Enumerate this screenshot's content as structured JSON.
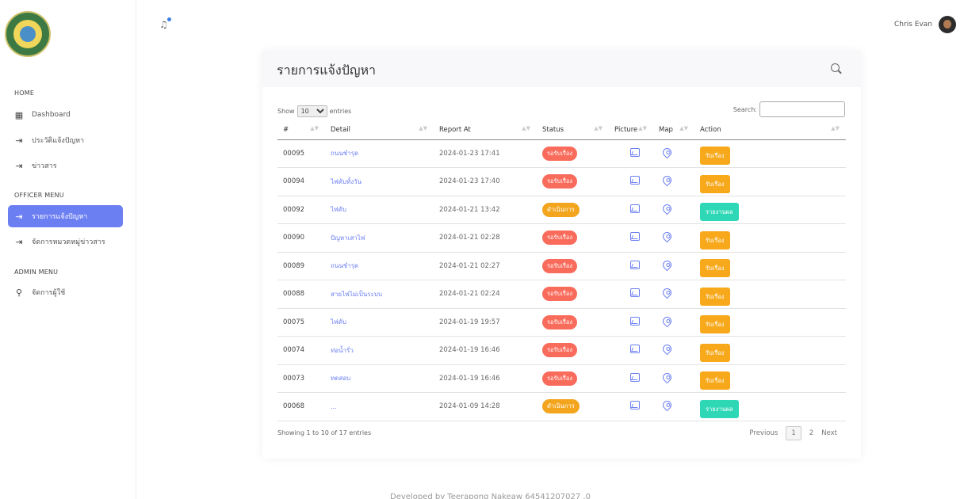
{
  "sidebar": {
    "home_heading": "HOME",
    "home_items": [
      {
        "label": "Dashboard",
        "icon": "grid-icon"
      },
      {
        "label": "ประวัติแจ้งปัญหา",
        "icon": "login-icon"
      },
      {
        "label": "ข่าวสาร",
        "icon": "login-icon"
      }
    ],
    "officer_heading": "OFFICER MENU",
    "officer_items": [
      {
        "label": "รายการแจ้งปัญหา",
        "icon": "login-icon",
        "active": true
      },
      {
        "label": "จัดการหมวดหมู่ข่าวสาร",
        "icon": "login-icon"
      }
    ],
    "admin_heading": "ADMIN MENU",
    "admin_items": [
      {
        "label": "จัดการผู้ใช้",
        "icon": "user-icon"
      }
    ]
  },
  "header": {
    "user_name": "Chris Evan"
  },
  "card": {
    "title": "รายการแจ้งปัญหา",
    "show_label": "Show",
    "entries_value": "10",
    "entries_label": "entries",
    "search_label": "Search:",
    "columns": [
      "#",
      "Detail",
      "Report At",
      "Status",
      "Picture",
      "Map",
      "Action"
    ],
    "rows": [
      {
        "id": "00095",
        "detail": "ถนนชำรุด",
        "report_at": "2024-01-23 17:41",
        "status": "รอรับเรื่อง",
        "status_type": "wait",
        "action": "รับเรื่อง",
        "action_type": "accept"
      },
      {
        "id": "00094",
        "detail": "ไฟดับทั้งวัน",
        "report_at": "2024-01-23 17:40",
        "status": "รอรับเรื่อง",
        "status_type": "wait",
        "action": "รับเรื่อง",
        "action_type": "accept"
      },
      {
        "id": "00092",
        "detail": "ไฟดับ",
        "report_at": "2024-01-21 13:42",
        "status": "ดำเนินการ",
        "status_type": "proc",
        "action": "รายงานผล",
        "action_type": "report"
      },
      {
        "id": "00090",
        "detail": "ปัญหาเสาไฟ",
        "report_at": "2024-01-21 02:28",
        "status": "รอรับเรื่อง",
        "status_type": "wait",
        "action": "รับเรื่อง",
        "action_type": "accept"
      },
      {
        "id": "00089",
        "detail": "ถนนชำรุด",
        "report_at": "2024-01-21 02:27",
        "status": "รอรับเรื่อง",
        "status_type": "wait",
        "action": "รับเรื่อง",
        "action_type": "accept"
      },
      {
        "id": "00088",
        "detail": "สายไฟไม่เป็นระบบ",
        "report_at": "2024-01-21 02:24",
        "status": "รอรับเรื่อง",
        "status_type": "wait",
        "action": "รับเรื่อง",
        "action_type": "accept"
      },
      {
        "id": "00075",
        "detail": "ไฟดับ",
        "report_at": "2024-01-19 19:57",
        "status": "รอรับเรื่อง",
        "status_type": "wait",
        "action": "รับเรื่อง",
        "action_type": "accept"
      },
      {
        "id": "00074",
        "detail": "ท่อน้ำรั่ว",
        "report_at": "2024-01-19 16:46",
        "status": "รอรับเรื่อง",
        "status_type": "wait",
        "action": "รับเรื่อง",
        "action_type": "accept"
      },
      {
        "id": "00073",
        "detail": "ทดสอบ",
        "report_at": "2024-01-19 16:46",
        "status": "รอรับเรื่อง",
        "status_type": "wait",
        "action": "รับเรื่อง",
        "action_type": "accept"
      },
      {
        "id": "00068",
        "detail": "...",
        "report_at": "2024-01-09 14:28",
        "status": "ดำเนินการ",
        "status_type": "proc",
        "action": "รายงานผล",
        "action_type": "report"
      }
    ],
    "info": "Showing 1 to 10 of 17 entries",
    "pager": {
      "previous": "Previous",
      "pages": [
        "1",
        "2"
      ],
      "next": "Next"
    }
  },
  "footer": {
    "text": "Developed by Teerapong Nakeaw 64541207027 .0"
  },
  "colors": {
    "accent": "#6c7ff2",
    "wait": "#f96b5b",
    "process": "#f3a51d",
    "accept": "#f7a81b",
    "report": "#2ed8b6"
  }
}
